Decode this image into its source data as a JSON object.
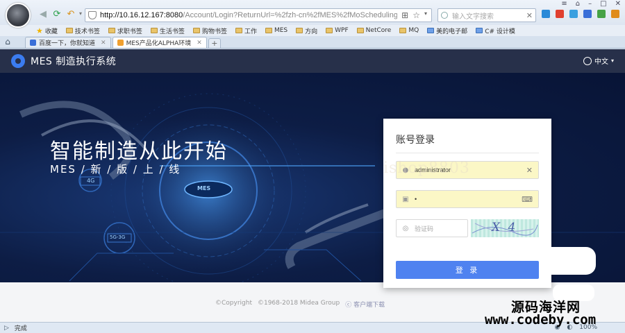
{
  "browser": {
    "url_host": "http://10.16.12.167:8080",
    "url_path": "/Account/Login?ReturnUrl=%2fzh-cn%2fMES%2fMoSchedulingElec",
    "search_placeholder": "输入文字搜索",
    "bookmarks": [
      {
        "label": "收藏",
        "icon": "star-icon"
      },
      {
        "label": "技术书签",
        "icon": "folder-icon"
      },
      {
        "label": "求职书签",
        "icon": "folder-icon"
      },
      {
        "label": "生活书签",
        "icon": "folder-icon"
      },
      {
        "label": "购物书签",
        "icon": "folder-icon"
      },
      {
        "label": "工作",
        "icon": "folder-icon"
      },
      {
        "label": "MES",
        "icon": "folder-icon"
      },
      {
        "label": "方向",
        "icon": "folder-icon"
      },
      {
        "label": "WPF",
        "icon": "folder-icon"
      },
      {
        "label": "NetCore",
        "icon": "folder-icon"
      },
      {
        "label": "MQ",
        "icon": "folder-icon"
      },
      {
        "label": "美的电子邮",
        "icon": "mail-icon"
      },
      {
        "label": "C# 设计模",
        "icon": "page-icon"
      }
    ],
    "tabs": [
      {
        "label": "百度一下，你就知道",
        "active": false,
        "color": "#3a6fd8"
      },
      {
        "label": "MES产品化ALPHA环境",
        "active": true,
        "color": "#f0a030"
      }
    ],
    "status": "完成",
    "zoom": "100%"
  },
  "app": {
    "title": "MES 制造执行系统",
    "language": "中文",
    "hero_title": "智能制造从此开始",
    "hero_subtitle": "MES / 新 / 版 / 上 / 线",
    "hero_badge": "MES",
    "hero_tags": [
      "4G",
      "5G-3G"
    ],
    "login": {
      "title": "账号登录",
      "username_value": "administrator",
      "password_value": "•",
      "captcha_placeholder": "验证码",
      "captcha_text": "X 4",
      "submit_label": "登 录"
    },
    "footer": {
      "copyright": "©Copyright",
      "years": "©1968-2018 Midea Group",
      "download": "客户端下载"
    }
  },
  "watermark": {
    "cn": "源码海洋网",
    "en": "www.codeby.com",
    "ghost": "ishop8803"
  },
  "colors": {
    "topbar": "#27304a",
    "hero": "#0d1d45",
    "primary": "#4f82f0",
    "autofill": "#fbf7c6"
  }
}
